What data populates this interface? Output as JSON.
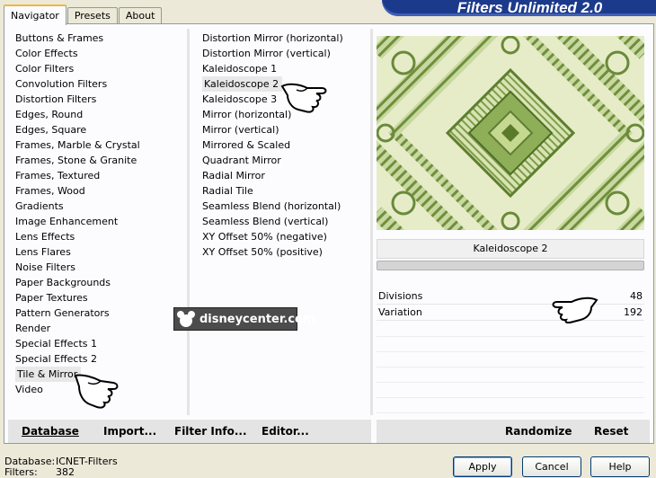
{
  "tabs": [
    "Navigator",
    "Presets",
    "About"
  ],
  "banner_title": "Filters Unlimited 2.0",
  "categories": [
    "Buttons & Frames",
    "Color Effects",
    "Color Filters",
    "Convolution Filters",
    "Distortion Filters",
    "Edges, Round",
    "Edges, Square",
    "Frames, Marble & Crystal",
    "Frames, Stone & Granite",
    "Frames, Textured",
    "Frames, Wood",
    "Gradients",
    "Image Enhancement",
    "Lens Effects",
    "Lens Flares",
    "Noise Filters",
    "Paper Backgrounds",
    "Paper Textures",
    "Pattern Generators",
    "Render",
    "Special Effects 1",
    "Special Effects 2",
    "Tile & Mirror",
    "Video"
  ],
  "selected_category": "Tile & Mirror",
  "filters": [
    "Distortion Mirror (horizontal)",
    "Distortion Mirror (vertical)",
    "Kaleidoscope 1",
    "Kaleidoscope 2",
    "Kaleidoscope 3",
    "Mirror (horizontal)",
    "Mirror (vertical)",
    "Mirrored & Scaled",
    "Quadrant Mirror",
    "Radial Mirror",
    "Radial Tile",
    "Seamless Blend (horizontal)",
    "Seamless Blend (vertical)",
    "XY Offset 50% (negative)",
    "XY Offset 50% (positive)"
  ],
  "selected_filter": "Kaleidoscope 2",
  "filter_name": "Kaleidoscope 2",
  "params": [
    {
      "label": "Divisions",
      "value": "48"
    },
    {
      "label": "Variation",
      "value": "192"
    }
  ],
  "left_buttons": {
    "database": "Database",
    "import": "Import...",
    "filter_info": "Filter Info...",
    "editor": "Editor..."
  },
  "right_buttons": {
    "randomize": "Randomize",
    "reset": "Reset"
  },
  "status": {
    "database_label": "Database:",
    "database_value": "ICNET-Filters",
    "filters_label": "Filters:",
    "filters_value": "382"
  },
  "dialog_buttons": {
    "apply": "Apply",
    "cancel": "Cancel",
    "help": "Help"
  },
  "watermark_text": "disneycenter.com",
  "colors": {
    "banner": "#1c3a8c",
    "panel": "#fcfcfe",
    "dialog": "#ece9d8",
    "preview_green": "#7a9a48"
  }
}
